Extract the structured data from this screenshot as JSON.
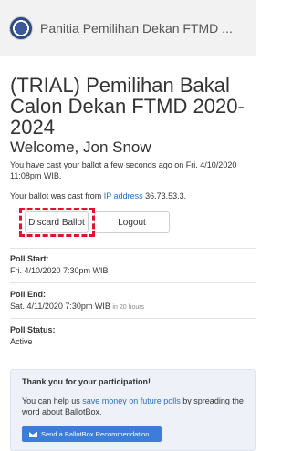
{
  "header": {
    "org_name": "Panitia Pemilihan Dekan FTMD ..."
  },
  "poll": {
    "title": "(TRIAL) Pemilihan Bakal Calon Dekan FTMD 2020-2024"
  },
  "voter": {
    "welcome": "Welcome, Jon Snow",
    "cast_msg": "You have cast your ballot a few seconds ago on Fri. 4/10/2020 11:08pm WIB.",
    "from_prefix": "Your ballot was cast from ",
    "ip_link": "IP address",
    "ip_value": " 36.73.53.3."
  },
  "actions": {
    "discard_label": "Discard Ballot",
    "logout_label": "Logout"
  },
  "details": {
    "start_label": "Poll Start:",
    "start_value": "Fri. 4/10/2020 7:30pm WIB",
    "end_label": "Poll End:",
    "end_value": "Sat. 4/11/2020 7:30pm WIB",
    "end_relative": "in 20 hours",
    "status_label": "Poll Status:",
    "status_value": "Active"
  },
  "thanks": {
    "title": "Thank you for your participation!",
    "text_prefix": "You can help us ",
    "text_link": "save money on future polls",
    "text_suffix": " by spreading the word about BallotBox.",
    "button_label": "Send a BallotBox Recommendation"
  },
  "colors": {
    "link": "#2a6fc2",
    "highlight": "#e0132a",
    "primary_button": "#3b7dd8"
  },
  "icons": {
    "logo": "organization-seal",
    "send": "envelope-icon"
  }
}
